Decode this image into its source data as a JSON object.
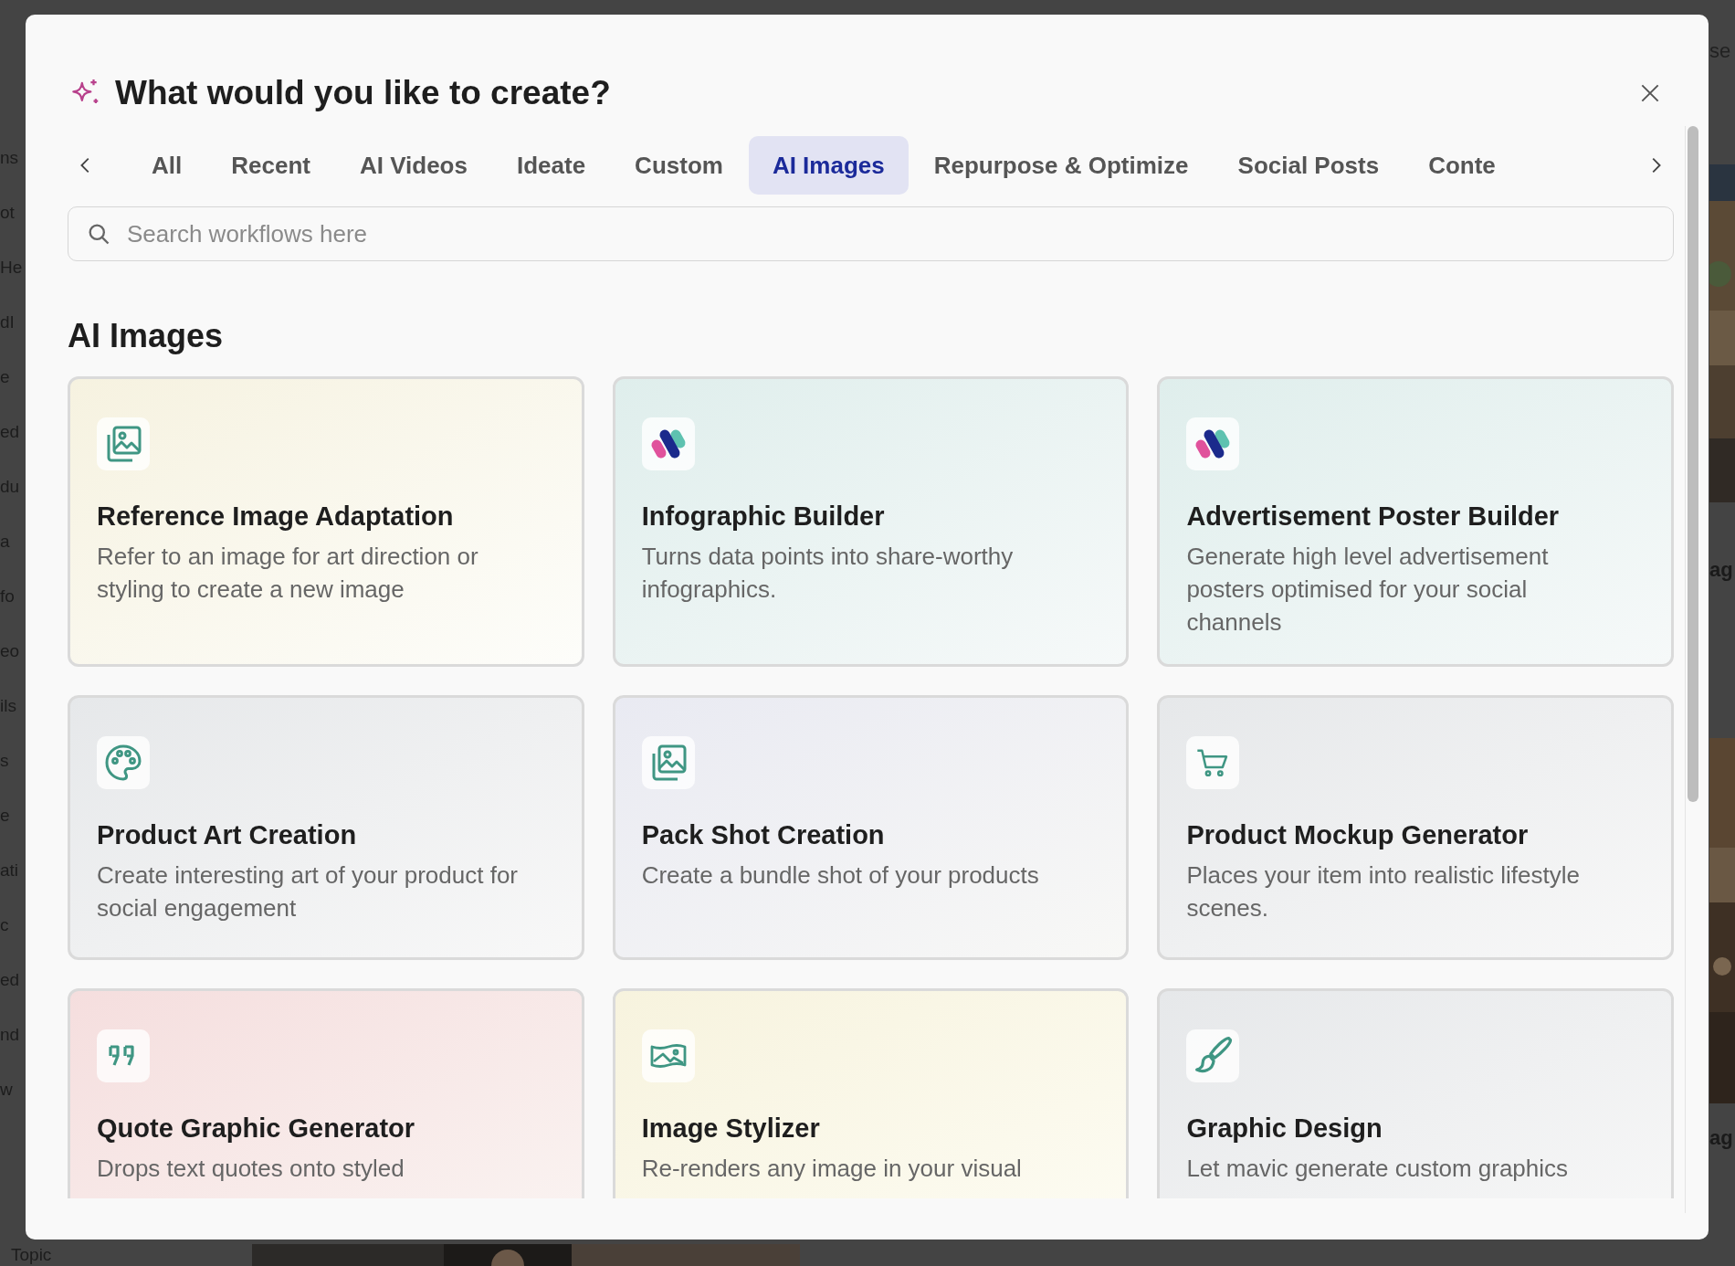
{
  "background": {
    "left_fragments": [
      "ns",
      "ot",
      "He",
      "dI",
      "e",
      "ed",
      "du",
      "a",
      "fo",
      "eo",
      "ils",
      "s",
      "e",
      "ati",
      "c",
      "ed",
      "nd",
      "w"
    ],
    "right_fragments": [
      "se",
      "ag",
      "ag"
    ],
    "bottom_fragment": "Topic"
  },
  "dialog": {
    "title": "What would you like to create?",
    "tabs": [
      {
        "label": "All",
        "selected": false
      },
      {
        "label": "Recent",
        "selected": false
      },
      {
        "label": "AI Videos",
        "selected": false
      },
      {
        "label": "Ideate",
        "selected": false
      },
      {
        "label": "Custom",
        "selected": false
      },
      {
        "label": "AI Images",
        "selected": true
      },
      {
        "label": "Repurpose & Optimize",
        "selected": false
      },
      {
        "label": "Social Posts",
        "selected": false
      },
      {
        "label": "Conte",
        "selected": false
      }
    ],
    "search": {
      "placeholder": "Search workflows here"
    },
    "section_title": "AI Images",
    "cards": [
      {
        "title": "Reference Image Adaptation",
        "description": "Refer to an image for art direction or styling to create a new image",
        "kind": "images"
      },
      {
        "title": "Infographic Builder",
        "description": "Turns data points into share-worthy infographics.",
        "kind": "logo"
      },
      {
        "title": "Advertisement Poster Builder",
        "description": "Generate high level advertisement posters optimised for your social channels",
        "kind": "logo"
      },
      {
        "title": "Product Art Creation",
        "description": "Create interesting art of your product for social engagement",
        "kind": "palette"
      },
      {
        "title": "Pack Shot Creation",
        "description": "Create a bundle shot of your products",
        "kind": "images"
      },
      {
        "title": "Product Mockup Generator",
        "description": "Places your item into realistic lifestyle scenes.",
        "kind": "cart"
      },
      {
        "title": "Quote Graphic Generator",
        "description": "Drops text quotes onto styled",
        "kind": "quote"
      },
      {
        "title": "Image Stylizer",
        "description": "Re-renders any image in your visual",
        "kind": "landscape"
      },
      {
        "title": "Graphic Design",
        "description": "Let mavic generate custom graphics",
        "kind": "brush"
      }
    ]
  }
}
